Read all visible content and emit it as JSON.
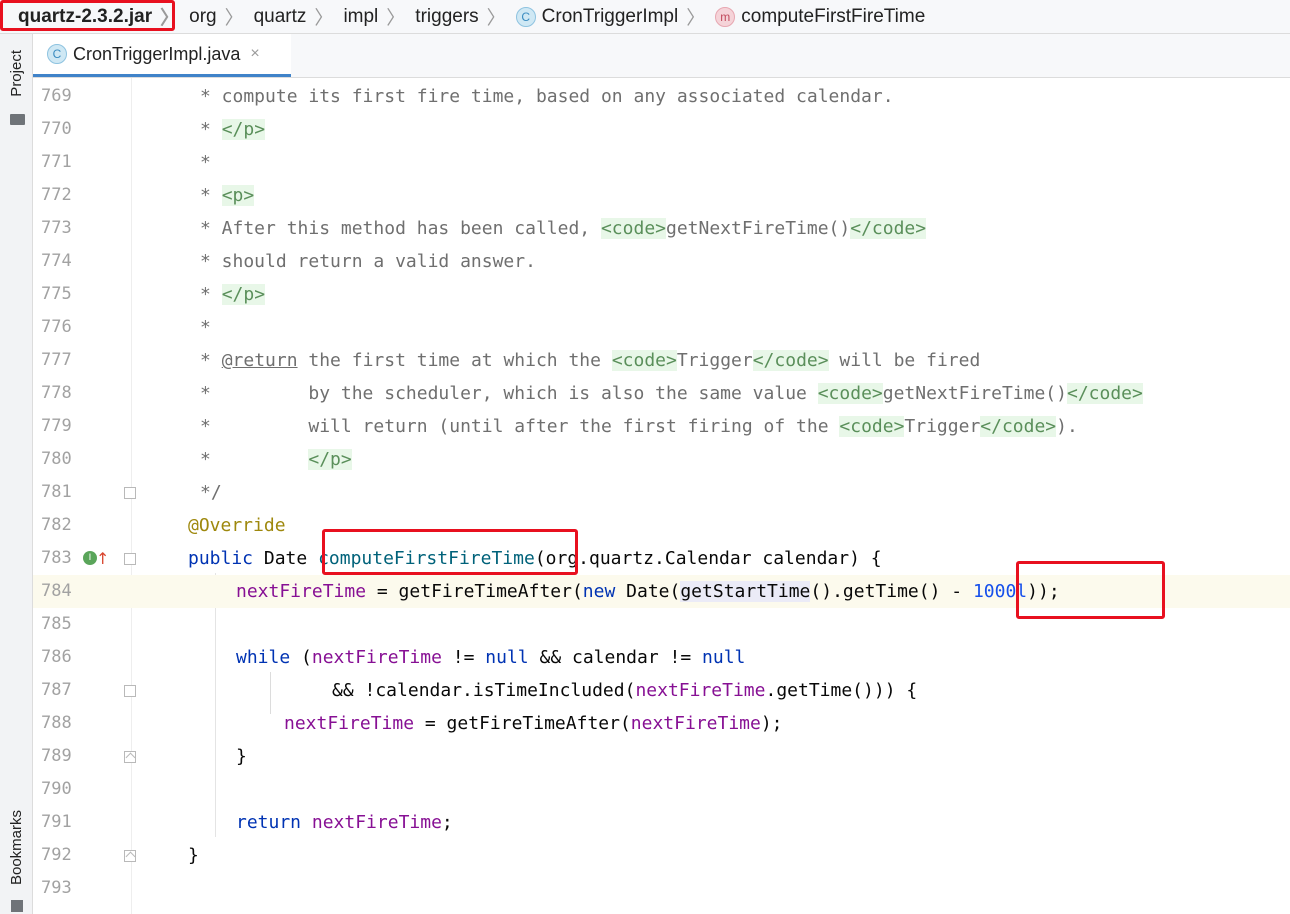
{
  "breadcrumb": {
    "items": [
      {
        "label": "quartz-2.3.2.jar"
      },
      {
        "label": "org"
      },
      {
        "label": "quartz"
      },
      {
        "label": "impl"
      },
      {
        "label": "triggers"
      },
      {
        "label": "CronTriggerImpl",
        "badge": "C"
      },
      {
        "label": "computeFirstFireTime",
        "badge": "m"
      }
    ]
  },
  "tool_strip": {
    "project_label": "Project",
    "bookmarks_label": "Bookmarks"
  },
  "tabs": [
    {
      "label": "CronTriggerImpl.java",
      "badge": "C",
      "close": "×"
    }
  ],
  "gutter": {
    "implements_marker": "I"
  },
  "editor": {
    "line_numbers": [
      "769",
      "770",
      "771",
      "772",
      "773",
      "774",
      "775",
      "776",
      "777",
      "778",
      "779",
      "780",
      "781",
      "782",
      "783",
      "784",
      "785",
      "786",
      "787",
      "788",
      "789",
      "790",
      "791",
      "792",
      "793"
    ],
    "current_line": "784",
    "lines": {
      "l769": "* compute its first fire time, based on any associated calendar.",
      "l770_a": "* ",
      "l770_b": "</p>",
      "l771": "*",
      "l772_a": "* ",
      "l772_b": "<p>",
      "l773_a": "* After this method has been called, ",
      "l773_b": "<code>",
      "l773_c": "getNextFireTime()",
      "l773_d": "</code>",
      "l774": "* should return a valid answer.",
      "l775_a": "* ",
      "l775_b": "</p>",
      "l776": "*",
      "l777_a": "* ",
      "l777_b": "@return",
      "l777_c": " the first time at which the ",
      "l777_d": "<code>",
      "l777_e": "Trigger",
      "l777_f": "</code>",
      "l777_g": " will be fired",
      "l778_a": "*         by the scheduler, which is also the same value ",
      "l778_b": "<code>",
      "l778_c": "getNextFireTime()",
      "l778_d": "</code>",
      "l779_a": "*         will return (until after the first firing of the ",
      "l779_b": "<code>",
      "l779_c": "Trigger",
      "l779_d": "</code>",
      "l779_e": ").",
      "l780_a": "*         ",
      "l780_b": "</p>",
      "l781": "*/",
      "l782": "@Override",
      "l783_a": "public",
      "l783_b": " Date ",
      "l783_c": "computeFirstFireTime",
      "l783_d": "(org.quartz.Calendar calendar) {",
      "l784_a": "nextFireTime",
      "l784_b": " = getFireTimeAfter(",
      "l784_c": "new",
      "l784_d": " Date(",
      "l784_e": "getStartTime",
      "l784_f": "().getTime() - ",
      "l784_g": "1000l",
      "l784_h": "));",
      "l786_a": "while",
      "l786_b": " (",
      "l786_c": "nextFireTime",
      "l786_d": " != ",
      "l786_e": "null",
      "l786_f": " && calendar != ",
      "l786_g": "null",
      "l787_a": "&& !calendar.isTimeIncluded(",
      "l787_b": "nextFireTime",
      "l787_c": ".getTime())) {",
      "l788_a": "nextFireTime",
      "l788_b": " = getFireTimeAfter(",
      "l788_c": "nextFireTime",
      "l788_d": ");",
      "l789": "}",
      "l791_a": "return",
      "l791_b": " ",
      "l791_c": "nextFireTime",
      "l791_d": ";",
      "l792": "}"
    }
  },
  "colors": {
    "keyword": "#0033b3",
    "field": "#871094",
    "method": "#00627a",
    "number": "#1750eb",
    "annotation": "#9e880d",
    "comment": "#6f6f6f",
    "html_tag": "#5a8f5a",
    "highlight_box": "#e8101f"
  }
}
